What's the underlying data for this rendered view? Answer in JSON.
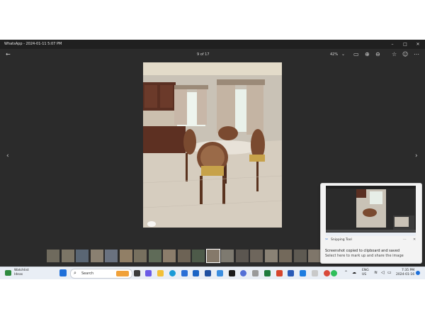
{
  "window": {
    "title": "WhatsApp - 2024-01-11 5:07 PM",
    "controls": [
      "–",
      "□",
      "✕"
    ]
  },
  "toolbar": {
    "back_icon": "←",
    "counter": "9 of 17",
    "zoom": "42%",
    "zoom_caret": "⌄",
    "icons": [
      "▭",
      "⊕",
      "⊖",
      "☆",
      "☺",
      "⋯"
    ]
  },
  "nav": {
    "prev": "‹",
    "next": "›"
  },
  "thumbnails_count": 23,
  "selected_thumbnail": 11,
  "toast": {
    "app_name": "Snipping Tool",
    "message": "Screenshot copied to clipboard and saved",
    "subtext": "Select here to mark up and share the image",
    "more": "⋯",
    "close": "✕"
  },
  "taskbar": {
    "weather_title": "Watchlist",
    "weather_sub": "Ideas",
    "search_label": "Search",
    "language": "ENG",
    "region": "US",
    "time": "7:35 PM",
    "date": "2024-01-16"
  },
  "colors": {
    "window_bg": "#2b2b2b",
    "titlebar_bg": "#202020",
    "taskbar_bg": "#e9eef5",
    "toast_bg": "#f3f3f3"
  }
}
